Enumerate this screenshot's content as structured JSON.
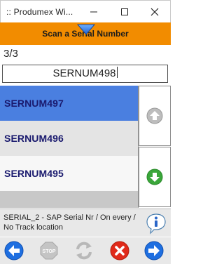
{
  "window": {
    "title": ":: Produmex Wi...",
    "minimize_glyph": "—",
    "maximize_glyph": "☐",
    "close_glyph": "✕"
  },
  "header": {
    "title": "Scan a Serial Number"
  },
  "counter": "3/3",
  "serial_input": {
    "value": "SERNUM498"
  },
  "list": {
    "items": [
      {
        "label": "SERNUM497",
        "selected": true
      },
      {
        "label": "SERNUM496",
        "selected": false
      },
      {
        "label": "SERNUM495",
        "selected": false
      }
    ]
  },
  "scroll": {
    "up_icon": "arrow-up-icon",
    "down_icon": "arrow-down-icon"
  },
  "info": {
    "text": "SERIAL_2 - SAP Serial Nr / On every / No Track location",
    "icon": "info-icon"
  },
  "toolbar": {
    "back_icon": "arrow-left-icon",
    "stop_label": "STOP",
    "refresh_icon": "refresh-icon",
    "cancel_icon": "cancel-icon",
    "next_icon": "arrow-right-icon"
  },
  "colors": {
    "header_orange": "#f28c00",
    "selected_row": "#4a7fe0",
    "list_text": "#1a1a6e",
    "toolbar_blue": "#1f6fe0",
    "cancel_red": "#e02a1a",
    "down_green": "#3aa63a"
  }
}
